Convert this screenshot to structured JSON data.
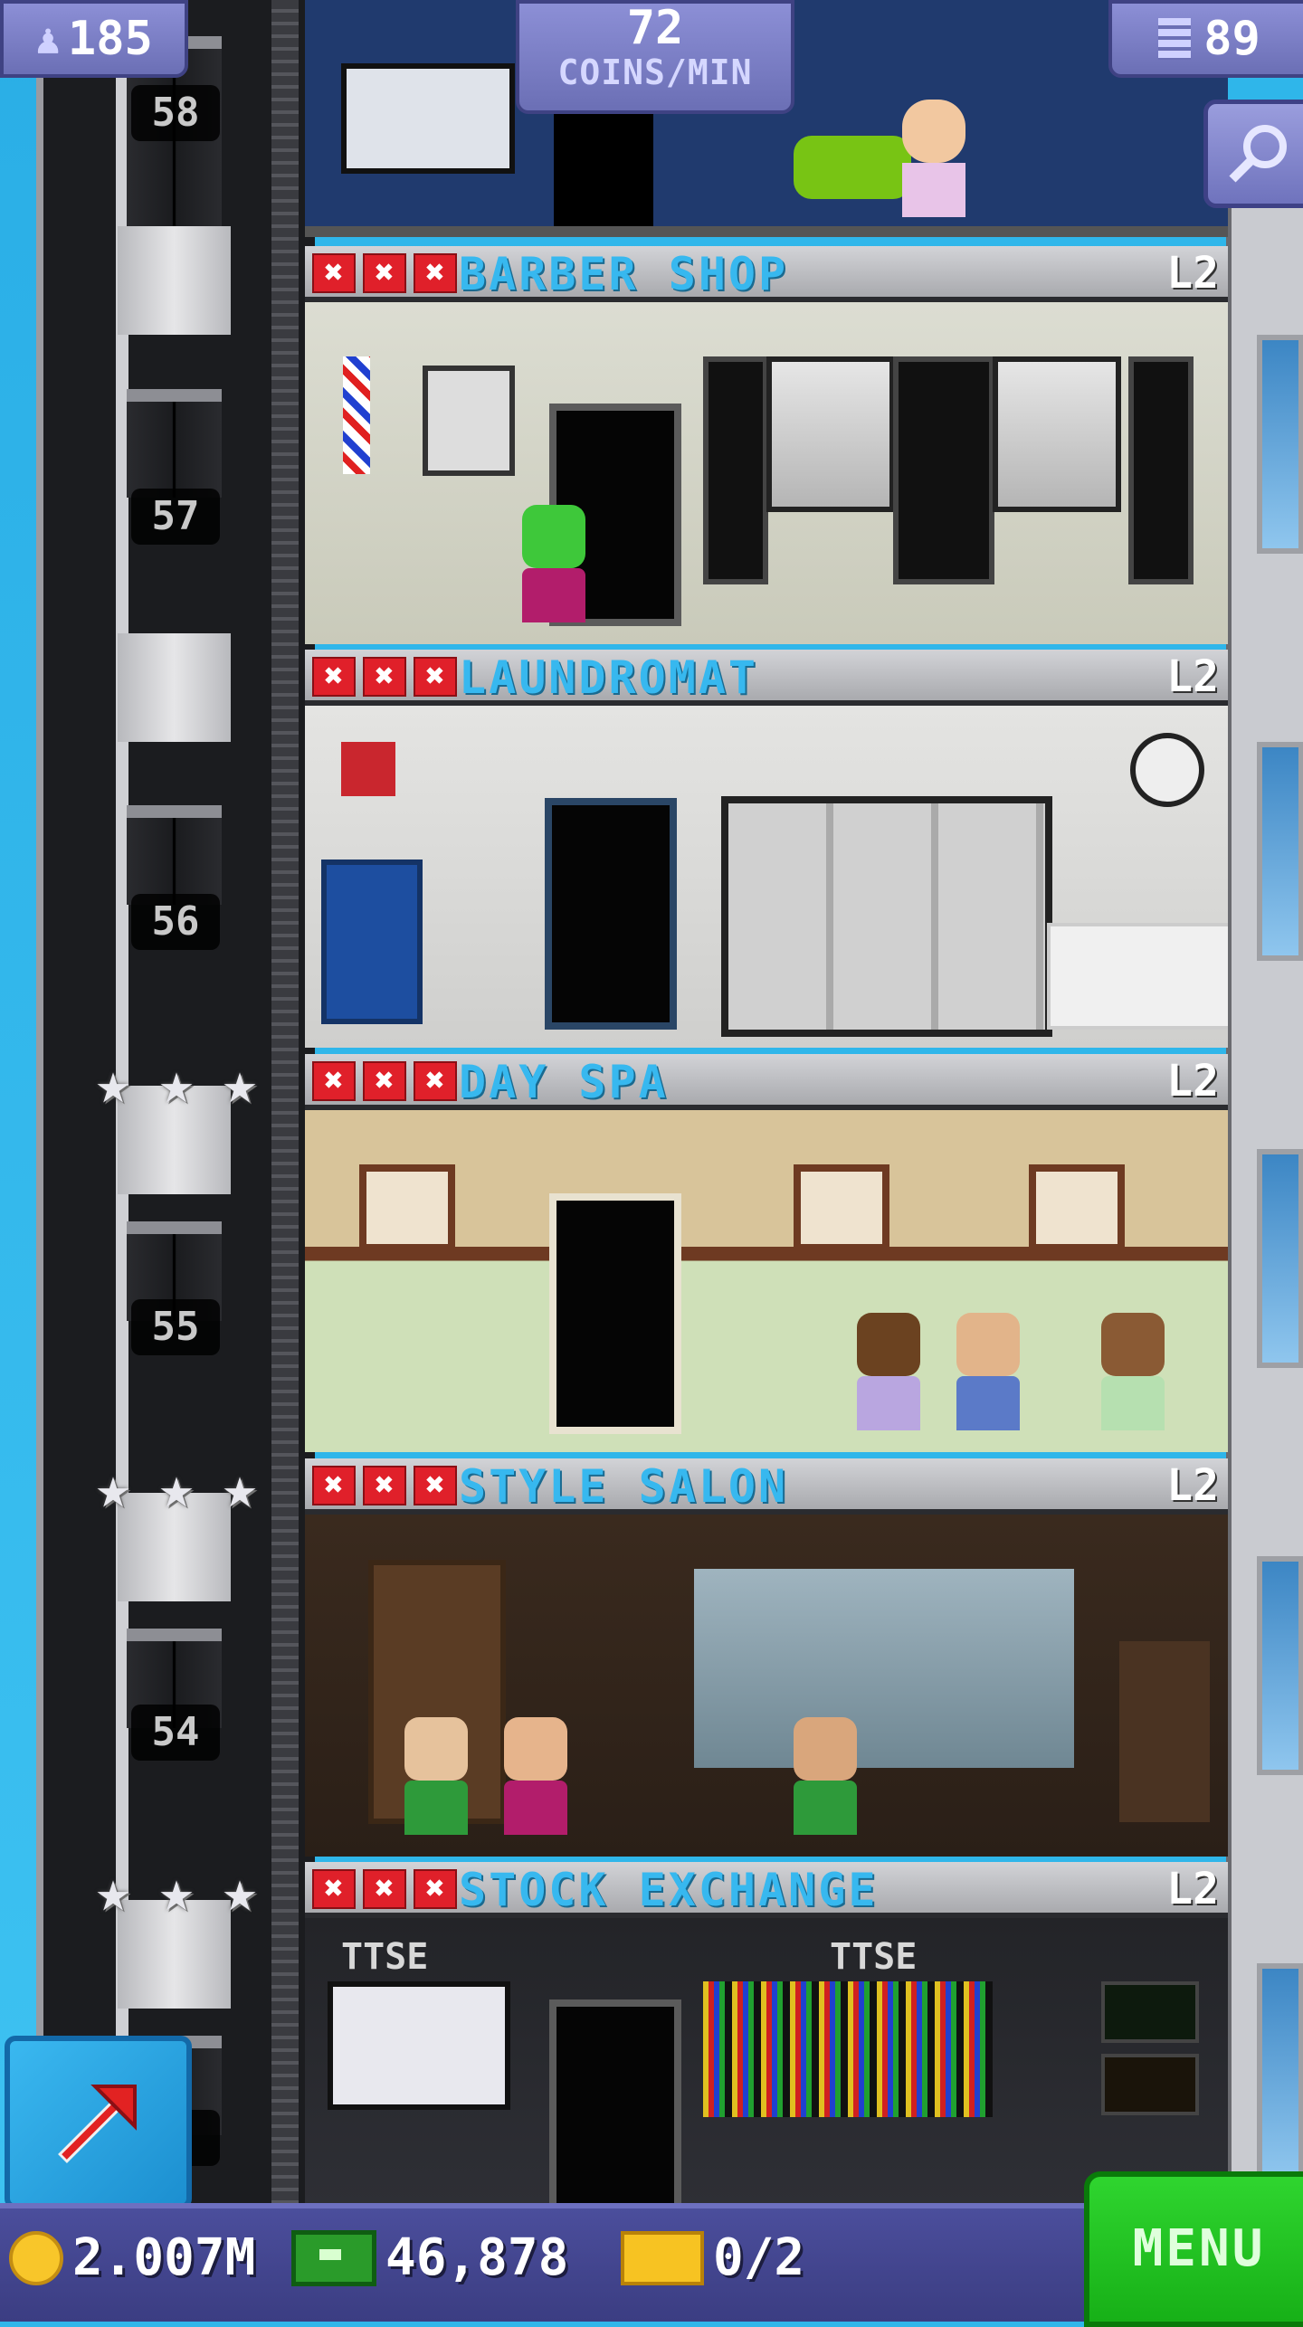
{
  "hud": {
    "population": "185",
    "coins_rate_value": "72",
    "coins_rate_unit": "COINS/MIN",
    "floors_count": "89"
  },
  "elevator_floor_labels": [
    "58",
    "57",
    "56",
    "55",
    "54",
    "3"
  ],
  "rooms": [
    {
      "name": "BARBER SHOP",
      "level": "L2",
      "stars": 0
    },
    {
      "name": "LAUNDROMAT",
      "level": "L2",
      "stars": 0
    },
    {
      "name": "DAY SPA",
      "level": "L2",
      "stars": 3
    },
    {
      "name": "STYLE SALON",
      "level": "L2",
      "stars": 3
    },
    {
      "name": "STOCK EXCHANGE",
      "level": "L2",
      "stars": 3
    }
  ],
  "room_marks": [
    "✖",
    "✖",
    "✖"
  ],
  "stock_signs": [
    "TTSE",
    "TTSE"
  ],
  "bottom_bar": {
    "coins": "2.007M",
    "bux": "46,878",
    "tickets": "0/2",
    "menu_label": "MENU"
  },
  "colors": {
    "room_name": "#37b8ef",
    "menu_green": "#17b017",
    "hud_purple": "#6b6fb5",
    "restock_red": "#e0202a"
  },
  "icons": [
    "person-icon",
    "building-icon",
    "search-icon",
    "elevator-arrow-icon",
    "coin-icon",
    "bux-icon",
    "ticket-icon",
    "star-icon",
    "restock-x-icon"
  ]
}
